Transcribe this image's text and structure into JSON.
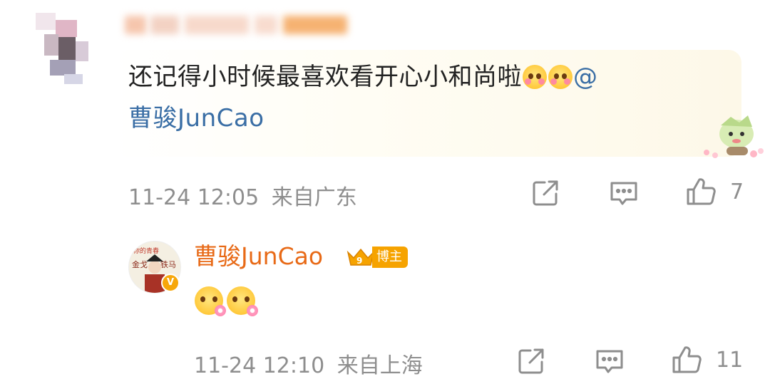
{
  "comment": {
    "author_name_hidden": true,
    "line1": "还记得小时候最喜欢看开心小和尚啦",
    "mention_symbol": "@",
    "mention": "曹骏JunCao",
    "emojis": [
      "crying-heart-emoji",
      "crying-heart-emoji"
    ],
    "timestamp": "11-24 12:05",
    "location": "来自广东",
    "like_count": "7"
  },
  "reply": {
    "author": "曹骏JunCao",
    "badge_label": "博主",
    "emojis": [
      "flower-face-emoji",
      "flower-face-emoji"
    ],
    "timestamp": "11-24 12:10",
    "location": "来自上海",
    "like_count": "11"
  },
  "icons": {
    "share": "share-icon",
    "comment": "comment-icon",
    "like": "thumbs-up-icon"
  },
  "colors": {
    "text": "#222222",
    "muted": "#8e8e8e",
    "mention": "#3a6ea5",
    "blogger_name": "#e86a17",
    "badge": "#f6a300"
  }
}
